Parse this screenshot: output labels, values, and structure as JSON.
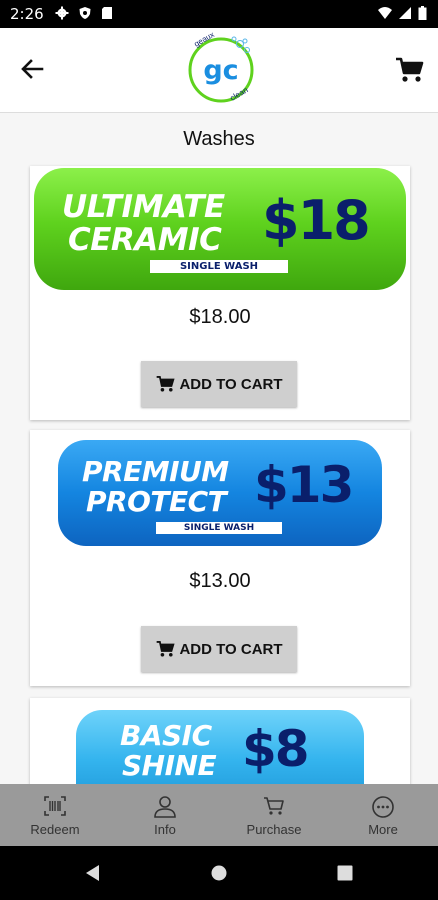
{
  "status_bar": {
    "time": "2:26"
  },
  "header": {
    "logo_text": "gc",
    "logo_arc_top": "geaux",
    "logo_arc_bottom": "clean"
  },
  "page": {
    "title": "Washes"
  },
  "colors": {
    "green_banner": "#5fd21e",
    "blue_banner": "#1485e0",
    "light_blue_banner": "#34b4ee",
    "navy": "#0a1f6b"
  },
  "products": [
    {
      "line1": "ULTIMATE",
      "line2": "CERAMIC",
      "banner_price": "$18",
      "subtitle": "SINGLE WASH",
      "price": "$18.00",
      "button": "ADD TO CART"
    },
    {
      "line1": "PREMIUM",
      "line2": "PROTECT",
      "banner_price": "$13",
      "subtitle": "SINGLE WASH",
      "price": "$13.00",
      "button": "ADD TO CART"
    },
    {
      "line1": "BASIC",
      "line2": "SHINE",
      "banner_price": "$8"
    }
  ],
  "bottom_nav": [
    {
      "label": "Redeem",
      "icon": "barcode-icon"
    },
    {
      "label": "Info",
      "icon": "person-icon"
    },
    {
      "label": "Purchase",
      "icon": "cart-icon"
    },
    {
      "label": "More",
      "icon": "more-icon"
    }
  ]
}
